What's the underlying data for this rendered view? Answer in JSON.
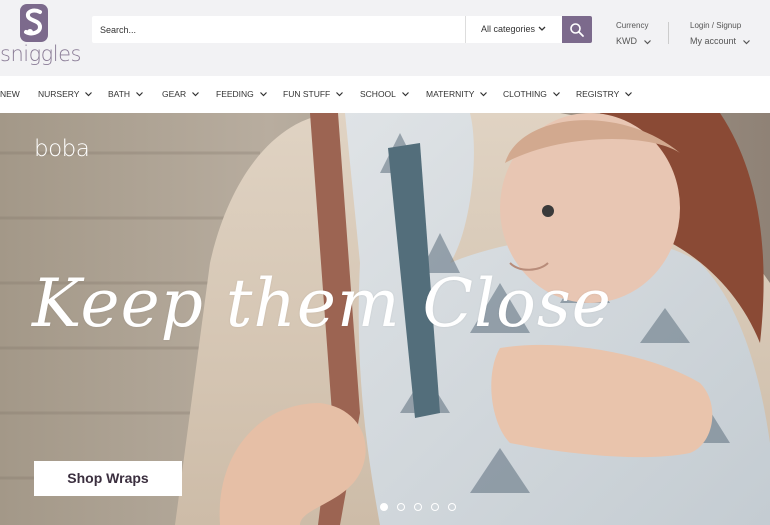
{
  "header": {
    "logo_text": "sniggles",
    "search": {
      "placeholder": "Search..."
    },
    "category_select": {
      "value": "All categories"
    },
    "currency": {
      "label": "Currency",
      "value": "KWD"
    },
    "account": {
      "label": "Login / Signup",
      "value": "My account"
    }
  },
  "nav": {
    "items": [
      {
        "label": "NEW",
        "has_dropdown": false
      },
      {
        "label": "NURSERY",
        "has_dropdown": true
      },
      {
        "label": "BATH",
        "has_dropdown": true
      },
      {
        "label": "GEAR",
        "has_dropdown": true
      },
      {
        "label": "FEEDING",
        "has_dropdown": true
      },
      {
        "label": "FUN STUFF",
        "has_dropdown": true
      },
      {
        "label": "SCHOOL",
        "has_dropdown": true
      },
      {
        "label": "MATERNITY",
        "has_dropdown": true
      },
      {
        "label": "CLOTHING",
        "has_dropdown": true
      },
      {
        "label": "REGISTRY",
        "has_dropdown": true
      }
    ]
  },
  "hero": {
    "brand": "boba",
    "tagline": "Keep them Close",
    "cta_label": "Shop Wraps",
    "slide_count": 5,
    "active_slide": 1
  },
  "colors": {
    "brand_purple": "#7c6a8c",
    "header_bg": "#f2f2f4",
    "text": "#333333"
  }
}
